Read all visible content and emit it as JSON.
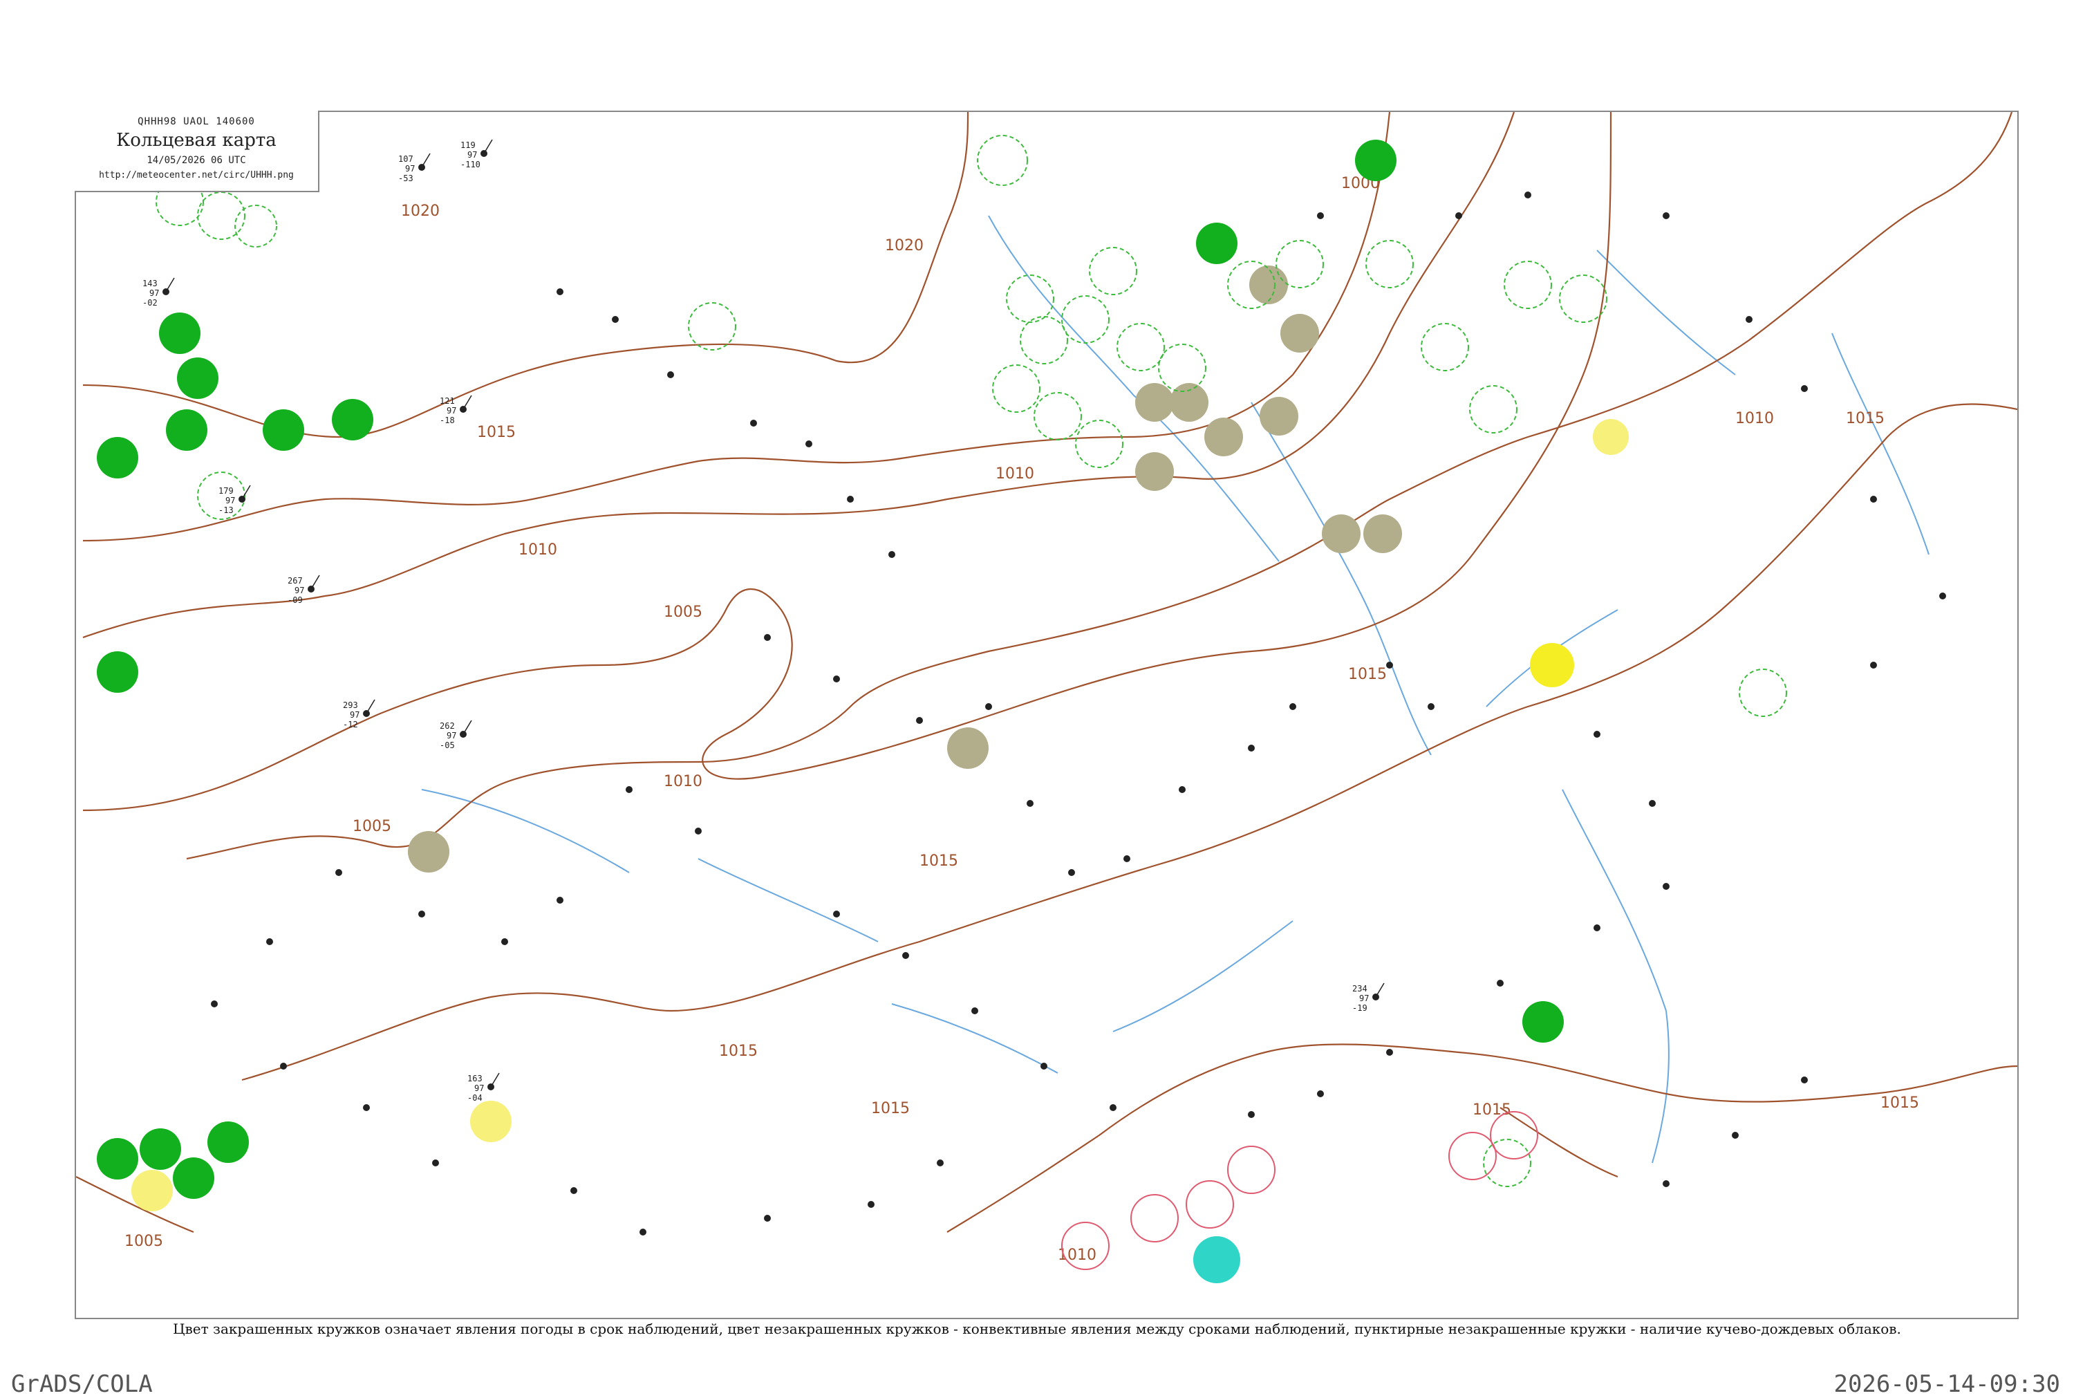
{
  "header": {
    "code": "QHHH98  UAOL  140600",
    "title": "Кольцевая карта",
    "time": "14/05/2026 06 UTC",
    "url": "http://meteocenter.net/circ/UHHH.png"
  },
  "isobars": {
    "labels": [
      "1020",
      "1020",
      "1015",
      "1010",
      "1005",
      "1010",
      "1015",
      "1010",
      "1015",
      "1000",
      "1010",
      "1015",
      "1015",
      "1015",
      "1015",
      "1005",
      "1005",
      "1010",
      "1015",
      "1015"
    ]
  },
  "colors": {
    "isobar": "#a0522d",
    "river": "#6aa8e0",
    "present_weather_green": "#12b01e",
    "fog_gray": "#b2ad8a",
    "yellow": "#f7f07a",
    "bright_yellow": "#f5ee25",
    "cyan": "#2fd6c8",
    "convective_ring_green": "#3dbb3d",
    "convective_ring_red": "#e05a70"
  },
  "stations_sample": [
    {
      "temp": "107",
      "dew": "-53",
      "pressure": "97"
    },
    {
      "temp": "119",
      "dew": "-110",
      "pressure": "97"
    },
    {
      "temp": "143",
      "dew": "-02",
      "pressure": "97"
    },
    {
      "temp": "121",
      "dew": "-18",
      "pressure": "97"
    },
    {
      "temp": "179",
      "dew": "-13",
      "pressure": "97"
    },
    {
      "temp": "267",
      "dew": "-09",
      "pressure": "97"
    },
    {
      "temp": "293",
      "dew": "-12",
      "pressure": "97"
    },
    {
      "temp": "163",
      "dew": "-04",
      "pressure": "97"
    },
    {
      "temp": "262",
      "dew": "-05",
      "pressure": "97"
    },
    {
      "temp": "234",
      "dew": "-19",
      "pressure": "97"
    }
  ],
  "footer": {
    "note": "Цвет закрашенных кружков означает явления погоды в срок наблюдений, цвет незакрашенных кружков - конвективные явления между сроками наблюдений, пунктирные незакрашенные кружки - наличие кучево-дождевых облаков.",
    "left": "GrADS/COLA",
    "right": "2026-05-14-09:30"
  }
}
